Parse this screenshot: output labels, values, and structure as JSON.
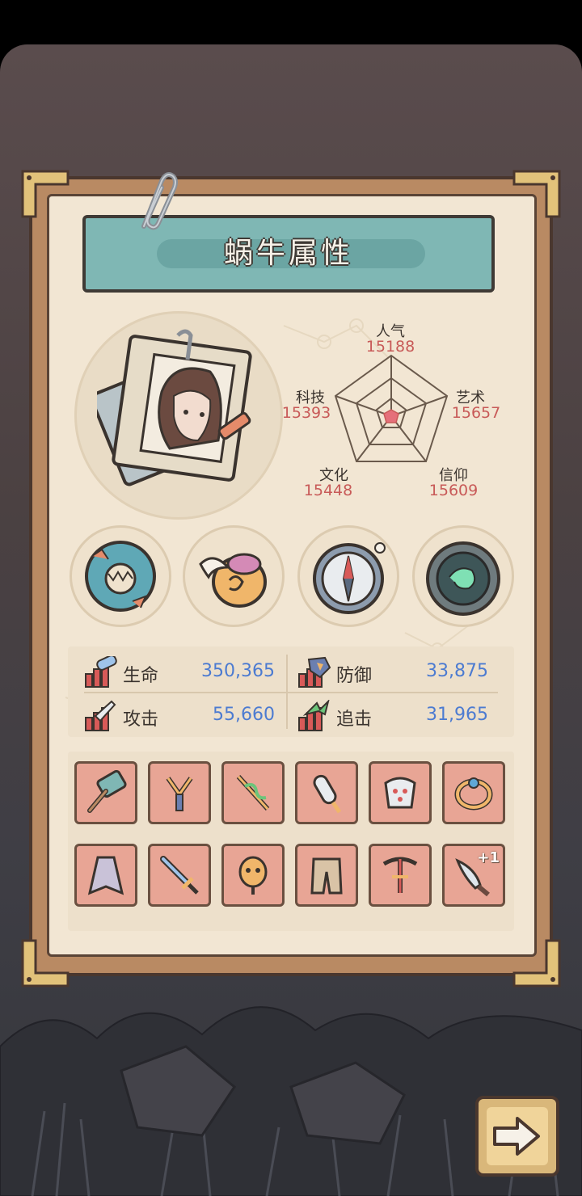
{
  "panel": {
    "title": "蜗牛属性"
  },
  "radar": {
    "stats": [
      {
        "label": "人气",
        "value": "15188"
      },
      {
        "label": "艺术",
        "value": "15657"
      },
      {
        "label": "信仰",
        "value": "15609"
      },
      {
        "label": "文化",
        "value": "15448"
      },
      {
        "label": "科技",
        "value": "15393"
      }
    ]
  },
  "medals": [
    {
      "icon": "shark-jaw-medal-icon"
    },
    {
      "icon": "winged-helmet-medal-icon"
    },
    {
      "icon": "compass-medal-icon"
    },
    {
      "icon": "jade-orb-medal-icon"
    }
  ],
  "combat": {
    "hp": {
      "label": "生命",
      "value": "350,365",
      "icon": "hp-stat-icon"
    },
    "defense": {
      "label": "防御",
      "value": "33,875",
      "icon": "defense-stat-icon"
    },
    "attack": {
      "label": "攻击",
      "value": "55,660",
      "icon": "attack-stat-icon"
    },
    "chase": {
      "label": "追击",
      "value": "31,965",
      "icon": "chase-stat-icon"
    }
  },
  "equipment": {
    "row1": [
      "hammer-icon",
      "slingshot-icon",
      "serpent-staff-icon",
      "rocket-icon",
      "armor-icon",
      "ring-icon"
    ],
    "row2": [
      "cloak-icon",
      "sword-icon",
      "mask-icon",
      "pants-icon",
      "crossbow-icon",
      "dagger-icon"
    ],
    "dagger_badge": "+1"
  },
  "colors": {
    "banner": "#7fb7b4",
    "paper": "#f2e6d3",
    "slot": "#e8a595",
    "stat_value": "#4c7bd1",
    "radar_value": "#c85a58"
  }
}
